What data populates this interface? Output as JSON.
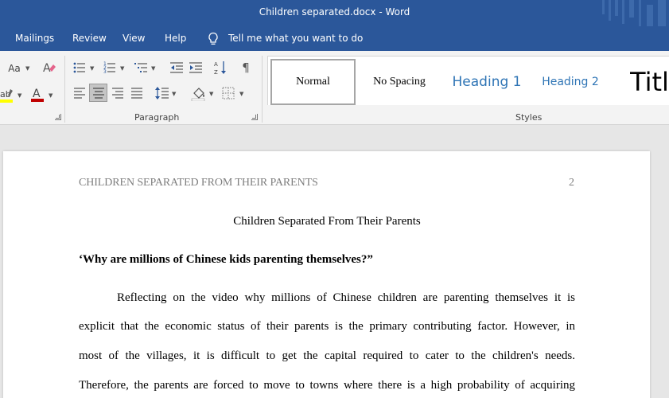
{
  "window": {
    "title": "Children separated.docx  -  Word"
  },
  "menu": {
    "items": [
      "Mailings",
      "Review",
      "View",
      "Help"
    ],
    "tell_me": "Tell me what you want to do"
  },
  "ribbon": {
    "font_group": {
      "change_case": "Aa",
      "font_color_glyph": "A",
      "highlight_glyph": "ab/"
    },
    "paragraph_group": {
      "label": "Paragraph"
    },
    "styles_group": {
      "label": "Styles",
      "items": [
        "Normal",
        "No Spacing",
        "Heading 1",
        "Heading 2",
        "Title"
      ],
      "selected": "Normal"
    },
    "colors": {
      "font_color": "#c00000",
      "highlight_color": "#ffff00",
      "heading_color": "#2e74b5"
    }
  },
  "document": {
    "header": "CHILDREN SEPARATED FROM THEIR PARENTS",
    "page_number": "2",
    "title": "Children Separated From Their Parents",
    "heading": "‘Why are millions of Chinese kids parenting themselves?”",
    "paragraph_lines": [
      "Reflecting on the video why millions of Chinese children are parenting themselves it is",
      "explicit that the economic status of their parents is the primary contributing factor. However, in",
      "most of the villages, it is difficult to get the capital required to cater to the children's needs.",
      "Therefore, the parents are forced to move to towns where there is a high probability of acquiring"
    ]
  }
}
